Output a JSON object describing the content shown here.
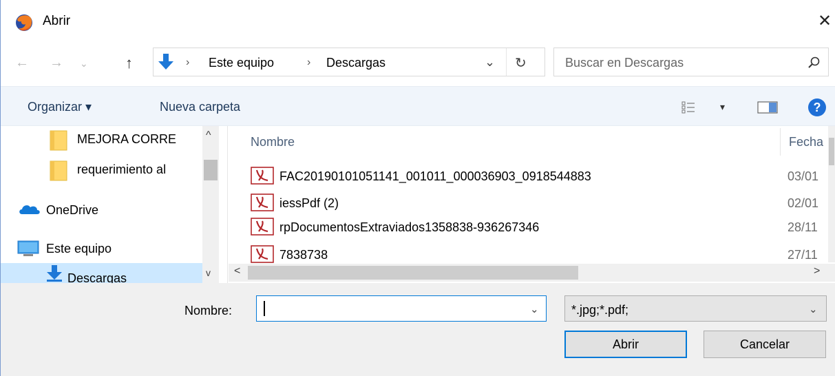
{
  "window": {
    "title": "Abrir",
    "app_icon": "firefox-icon",
    "close_label": "✕"
  },
  "address": {
    "back": "←",
    "forward": "→",
    "recent": "⌄",
    "up": "↑",
    "crumbs": [
      "Este equipo",
      "Descargas"
    ],
    "separator": "›",
    "dropdown": "⌄",
    "refresh": "↻"
  },
  "search": {
    "placeholder": "Buscar en Descargas"
  },
  "toolbar": {
    "organize_label": "Organizar ▾",
    "new_folder_label": "Nueva carpeta",
    "view_dropdown": "▾"
  },
  "nav": {
    "items": [
      {
        "label": "MEJORA CORRE",
        "icon": "folder-icon"
      },
      {
        "label": "requerimiento al",
        "icon": "folder-icon"
      },
      {
        "label": "OneDrive",
        "icon": "onedrive-icon"
      },
      {
        "label": "Este equipo",
        "icon": "computer-icon"
      },
      {
        "label": "Descargas",
        "icon": "downloads-icon"
      }
    ],
    "scroll_up": "^",
    "scroll_down": "v"
  },
  "files": {
    "columns": {
      "name": "Nombre",
      "date": "Fecha"
    },
    "rows": [
      {
        "name": "FAC20190101051141_001011_000036903_0918544883",
        "date": "03/01"
      },
      {
        "name": "iessPdf (2)",
        "date": "02/01"
      },
      {
        "name": "rpDocumentosExtraviados1358838-936267346",
        "date": "28/11"
      },
      {
        "name": "7838738",
        "date": "27/11"
      }
    ],
    "scroll_left": "<",
    "scroll_right": ">"
  },
  "bottom": {
    "name_label": "Nombre:",
    "name_value": "",
    "name_dropdown": "⌄",
    "file_type": "*.jpg;*.pdf;",
    "file_type_dropdown": "⌄",
    "open_label": "Abrir",
    "cancel_label": "Cancelar"
  }
}
